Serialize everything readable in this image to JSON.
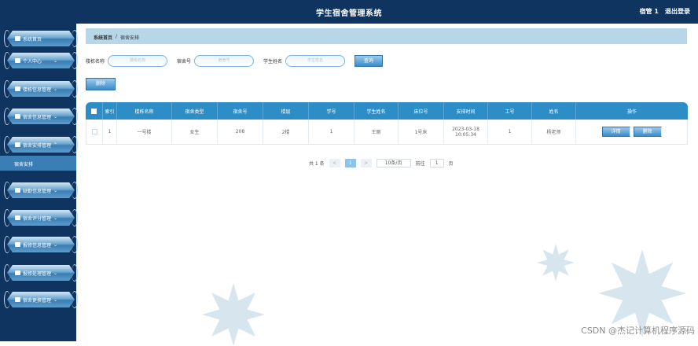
{
  "header": {
    "title": "学生宿舍管理系统",
    "user": "宿管 1",
    "logout": "退出登录"
  },
  "sidebar": {
    "items": [
      {
        "label": "系统首页",
        "icon": "home-icon"
      },
      {
        "label": "个人中心",
        "icon": "user-icon"
      },
      {
        "label": "楼栋信息管理",
        "icon": "grid-icon"
      },
      {
        "label": "宿舍信息管理",
        "icon": "grid-icon"
      },
      {
        "label": "宿舍安排管理",
        "icon": "grid-icon"
      },
      {
        "label": "缺勤信息管理",
        "icon": "clipboard-icon"
      },
      {
        "label": "宿舍评分管理",
        "icon": "grid-icon"
      },
      {
        "label": "报修信息管理",
        "icon": "tool-icon"
      },
      {
        "label": "报修处理管理",
        "icon": "grid-icon"
      },
      {
        "label": "宿舍更换管理",
        "icon": "swap-icon"
      }
    ],
    "active_sub": "宿舍安排"
  },
  "breadcrumb": {
    "home": "系统首页",
    "sep": "/",
    "current": "宿舍安排"
  },
  "search": {
    "building_label": "楼栋名称",
    "building_placeholder": "楼栋名称",
    "room_label": "宿舍号",
    "room_placeholder": "宿舍号",
    "student_label": "学生姓名",
    "student_placeholder": "学生姓名",
    "query_button": "查询"
  },
  "delete_button": "删除",
  "table": {
    "headers": [
      "索引",
      "楼栋名称",
      "宿舍类型",
      "宿舍号",
      "楼层",
      "学号",
      "学生姓名",
      "床位号",
      "安排时间",
      "工号",
      "姓名",
      "操作"
    ],
    "rows": [
      [
        "1",
        "一号楼",
        "女生",
        "208",
        "2楼",
        "1",
        "王丽",
        "1号床",
        "2023-03-18 10:05:34",
        "1",
        "杨老师"
      ]
    ],
    "detail_button": "详情",
    "delete_button": "删除"
  },
  "pager": {
    "total": "共 1 条",
    "prev": "<",
    "page": "1",
    "next": ">",
    "page_size": "10条/页",
    "goto_label": "前往",
    "goto_value": "1",
    "page_unit": "页"
  },
  "watermark": "CSDN @杰记计算机程序源码"
}
